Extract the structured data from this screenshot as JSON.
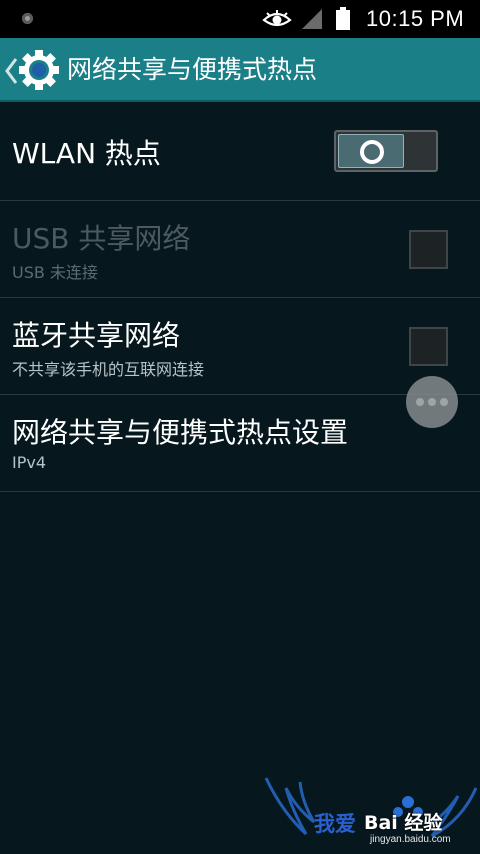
{
  "status_bar": {
    "time": "10:15 PM",
    "icons": [
      "notification-dot-icon",
      "eye-icon",
      "signal-icon",
      "battery-icon"
    ]
  },
  "action_bar": {
    "title": "网络共享与便携式热点",
    "icon": "gear-icon",
    "back": "chevron-left-icon"
  },
  "preferences": [
    {
      "title": "WLAN 热点",
      "summary": "",
      "widget": "switch",
      "checked": true,
      "enabled": true
    },
    {
      "title": "USB 共享网络",
      "summary": "USB 未连接",
      "widget": "checkbox",
      "checked": false,
      "enabled": false
    },
    {
      "title": "蓝牙共享网络",
      "summary": "不共享该手机的互联网连接",
      "widget": "checkbox",
      "checked": false,
      "enabled": true
    },
    {
      "title": "网络共享与便携式热点设置",
      "summary": "IPv4",
      "widget": "none",
      "enabled": true
    }
  ],
  "overflow_menu": {
    "icon": "more-dots-icon"
  },
  "watermark": {
    "text": "我爱",
    "brand": "Bai 经验",
    "url": "jingyan.baidu.com"
  },
  "colors": {
    "background": "#06181e",
    "action_bar": "#1b7f88",
    "status_bar": "#000000",
    "divider": "#253941"
  }
}
